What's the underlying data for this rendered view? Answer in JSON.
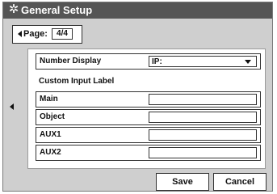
{
  "window": {
    "title": "General Setup",
    "title_icon": "gear-icon"
  },
  "pager": {
    "label": "Page:",
    "value": "4/4"
  },
  "form": {
    "number_display": {
      "label": "Number Display",
      "value": "IP:"
    },
    "custom_input_label": "Custom Input Label",
    "fields": [
      {
        "label": "Main",
        "value": ""
      },
      {
        "label": "Object",
        "value": ""
      },
      {
        "label": "AUX1",
        "value": ""
      },
      {
        "label": "AUX2",
        "value": ""
      }
    ]
  },
  "buttons": {
    "save": "Save",
    "cancel": "Cancel"
  },
  "colors": {
    "titlebar": "#555555",
    "panel": "#cfcfcf",
    "content": "#ffffff"
  }
}
